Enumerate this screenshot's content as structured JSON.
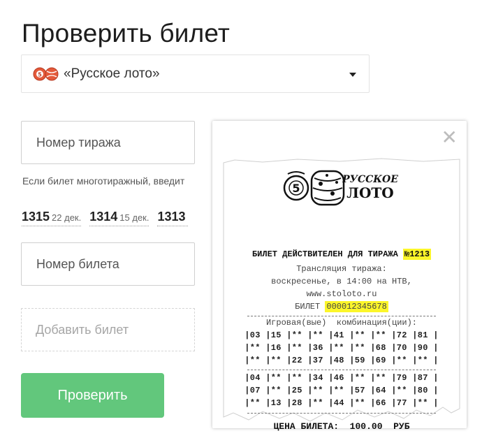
{
  "page": {
    "title": "Проверить билет"
  },
  "game_select": {
    "label": "«Русское лото»",
    "logo_icon": "russkoe-loto-barrels-icon"
  },
  "draw_input": {
    "placeholder": "Номер тиража"
  },
  "hint": {
    "text": "Если билет многотиражный, введит"
  },
  "recent_draws": [
    {
      "number": "1315",
      "date": "22 дек."
    },
    {
      "number": "1314",
      "date": "15 дек."
    },
    {
      "number": "1313",
      "date": ""
    }
  ],
  "ticket_input": {
    "placeholder": "Номер билета"
  },
  "add_ticket": {
    "label": "Добавить билет"
  },
  "check_button": {
    "label": "Проверить"
  },
  "popup": {
    "close_icon": "close-icon",
    "logo_text": [
      "РУССКОЕ",
      "ЛОТО"
    ],
    "logo_ball_number": "5",
    "header_text": "БИЛЕТ ДЕЙСТВИТЕЛЕН ДЛЯ ТИРАЖА",
    "draw_number": "№1213",
    "broadcast_lines": [
      "Трансляция тиража:",
      "воскресенье, в 14:00 на НТВ,",
      "www.stoloto.ru"
    ],
    "ticket_label": "БИЛЕТ",
    "ticket_number": "000012345678",
    "combinations_label": "Игровая(вые)  комбинация(ции):",
    "field1": [
      "|03 |15 |** |** |41 |** |** |72 |81 |",
      "|** |16 |** |36 |** |** |68 |70 |90 |",
      "|** |** |22 |37 |48 |59 |69 |** |** |"
    ],
    "field2": [
      "|04 |** |** |34 |46 |** |** |79 |87 |",
      "|07 |** |25 |** |** |57 |64 |** |80 |",
      "|** |13 |28 |** |44 |** |66 |77 |** |"
    ],
    "price": "ЦЕНА БИЛЕТА:  100.00  РУБ",
    "highlight_color": "#fcf62a"
  },
  "colors": {
    "button_green": "#62c77c",
    "border": "#cfcfcf"
  }
}
